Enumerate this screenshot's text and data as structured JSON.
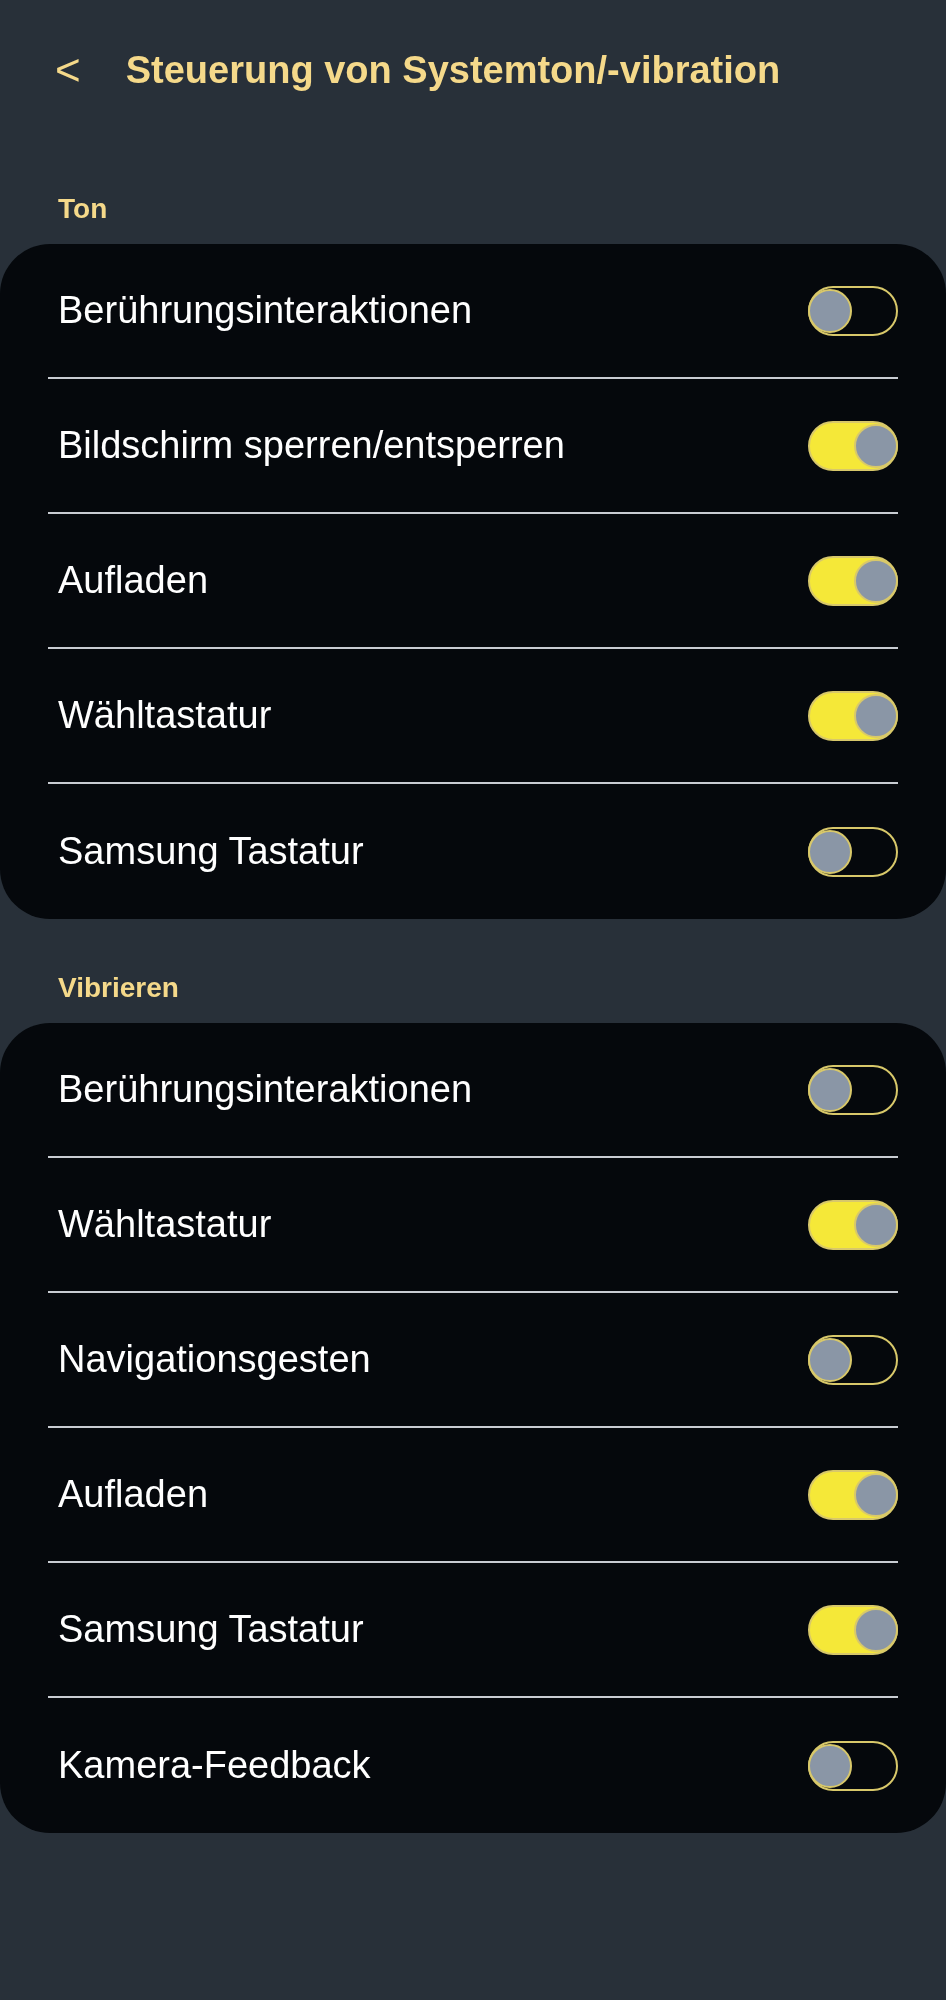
{
  "header": {
    "back": "<",
    "title": "Steuerung von Systemton/-vibration"
  },
  "sections": [
    {
      "title": "Ton",
      "items": [
        {
          "label": "Berührungsinteraktionen",
          "on": false
        },
        {
          "label": "Bildschirm sperren/entsperren",
          "on": true
        },
        {
          "label": "Aufladen",
          "on": true
        },
        {
          "label": "Wähltastatur",
          "on": true
        },
        {
          "label": "Samsung Tastatur",
          "on": false
        }
      ]
    },
    {
      "title": "Vibrieren",
      "items": [
        {
          "label": "Berührungsinteraktionen",
          "on": false
        },
        {
          "label": "Wähltastatur",
          "on": true
        },
        {
          "label": "Navigationsgesten",
          "on": false
        },
        {
          "label": "Aufladen",
          "on": true
        },
        {
          "label": "Samsung Tastatur",
          "on": true
        },
        {
          "label": "Kamera-Feedback",
          "on": false
        }
      ]
    }
  ]
}
